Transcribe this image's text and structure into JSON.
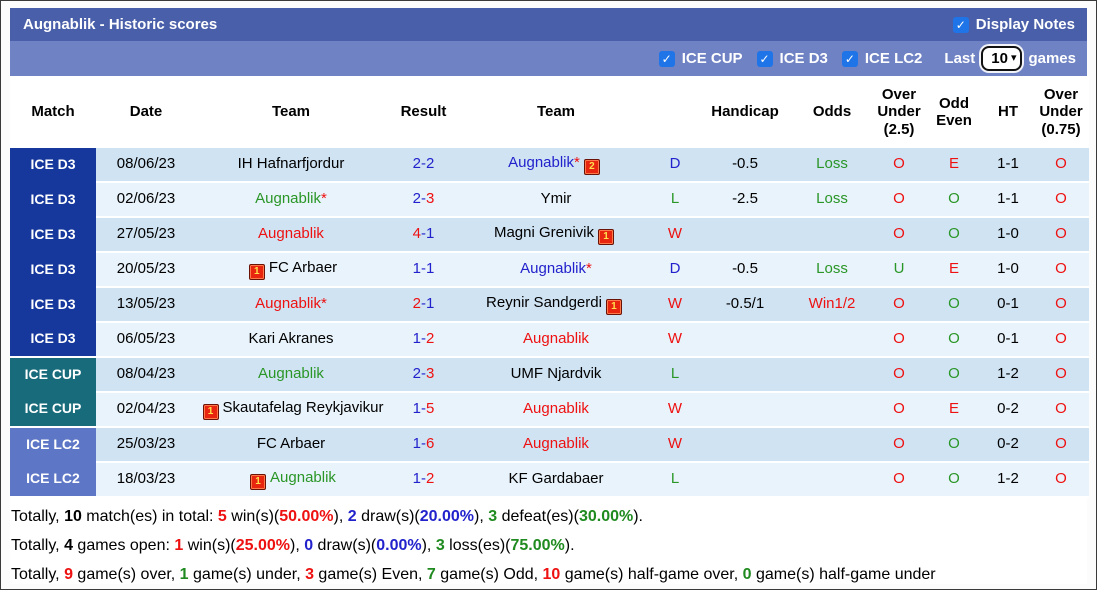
{
  "title_bar": {
    "title": "Augnablik - Historic scores",
    "display_notes_label": "Display Notes",
    "display_notes_checked": true
  },
  "filter_bar": {
    "competitions": [
      {
        "label": "ICE CUP",
        "checked": true
      },
      {
        "label": "ICE D3",
        "checked": true
      },
      {
        "label": "ICE LC2",
        "checked": true
      }
    ],
    "last_label": "Last",
    "last_value": "10",
    "games_label": "games"
  },
  "colors": {
    "title_bar": "#4a5fa9",
    "filter_bar": "#6f82c4",
    "league_ice_d3": "#16389d",
    "league_ice_cup": "#176b7b",
    "league_ice_lc2": "#5d76c5",
    "row_odd": "#cfe3f3",
    "row_even": "#e9f3fb",
    "win_red": "#ee1111",
    "draw_blue": "#2222cc",
    "loss_green": "#2a9627",
    "checkbox_blue": "#1f75e8"
  },
  "table": {
    "columns": [
      "Match",
      "Date",
      "Team",
      "Result",
      "Team",
      "",
      "Handicap",
      "Odds",
      "Over Under (2.5)",
      "Odd Even",
      "HT",
      "Over Under (0.75)"
    ],
    "rows": [
      {
        "league": "ICE D3",
        "lkey": "d3",
        "date": "08/06/23",
        "home": {
          "name": "IH Hafnarfjordur",
          "color": "black"
        },
        "score": {
          "h": "2",
          "a": "2",
          "hc": "blue",
          "ac": "blue"
        },
        "away": {
          "name": "Augnablik",
          "color": "blue",
          "star": true,
          "badge": "2",
          "badge_pos": "after"
        },
        "outcome": {
          "t": "D",
          "c": "blue"
        },
        "handicap": "-0.5",
        "odds": {
          "t": "Loss",
          "c": "green"
        },
        "ou25": {
          "t": "O",
          "c": "red"
        },
        "oe": {
          "t": "E",
          "c": "red"
        },
        "ht": "1-1",
        "ou075": {
          "t": "O",
          "c": "red"
        }
      },
      {
        "league": "ICE D3",
        "lkey": "d3",
        "date": "02/06/23",
        "home": {
          "name": "Augnablik",
          "color": "green",
          "star": true
        },
        "score": {
          "h": "2",
          "a": "3",
          "hc": "blue",
          "ac": "red"
        },
        "away": {
          "name": "Ymir",
          "color": "black"
        },
        "outcome": {
          "t": "L",
          "c": "green"
        },
        "handicap": "-2.5",
        "odds": {
          "t": "Loss",
          "c": "green"
        },
        "ou25": {
          "t": "O",
          "c": "red"
        },
        "oe": {
          "t": "O",
          "c": "green"
        },
        "ht": "1-1",
        "ou075": {
          "t": "O",
          "c": "red"
        }
      },
      {
        "league": "ICE D3",
        "lkey": "d3",
        "date": "27/05/23",
        "home": {
          "name": "Augnablik",
          "color": "red"
        },
        "score": {
          "h": "4",
          "a": "1",
          "hc": "red",
          "ac": "blue"
        },
        "away": {
          "name": "Magni Grenivik",
          "color": "black",
          "badge": "1",
          "badge_pos": "after"
        },
        "outcome": {
          "t": "W",
          "c": "red"
        },
        "handicap": "",
        "odds": {
          "t": "",
          "c": "black"
        },
        "ou25": {
          "t": "O",
          "c": "red"
        },
        "oe": {
          "t": "O",
          "c": "green"
        },
        "ht": "1-0",
        "ou075": {
          "t": "O",
          "c": "red"
        }
      },
      {
        "league": "ICE D3",
        "lkey": "d3",
        "date": "20/05/23",
        "home": {
          "name": "FC Arbaer",
          "color": "black",
          "badge": "1",
          "badge_pos": "before"
        },
        "score": {
          "h": "1",
          "a": "1",
          "hc": "blue",
          "ac": "blue"
        },
        "away": {
          "name": "Augnablik",
          "color": "blue",
          "star": true
        },
        "outcome": {
          "t": "D",
          "c": "blue"
        },
        "handicap": "-0.5",
        "odds": {
          "t": "Loss",
          "c": "green"
        },
        "ou25": {
          "t": "U",
          "c": "green"
        },
        "oe": {
          "t": "E",
          "c": "red"
        },
        "ht": "1-0",
        "ou075": {
          "t": "O",
          "c": "red"
        }
      },
      {
        "league": "ICE D3",
        "lkey": "d3",
        "date": "13/05/23",
        "home": {
          "name": "Augnablik",
          "color": "red",
          "star": true
        },
        "score": {
          "h": "2",
          "a": "1",
          "hc": "red",
          "ac": "blue"
        },
        "away": {
          "name": "Reynir Sandgerdi",
          "color": "black",
          "badge": "1",
          "badge_pos": "after"
        },
        "outcome": {
          "t": "W",
          "c": "red"
        },
        "handicap": "-0.5/1",
        "odds": {
          "t": "Win1/2",
          "c": "red"
        },
        "ou25": {
          "t": "O",
          "c": "red"
        },
        "oe": {
          "t": "O",
          "c": "green"
        },
        "ht": "0-1",
        "ou075": {
          "t": "O",
          "c": "red"
        }
      },
      {
        "league": "ICE D3",
        "lkey": "d3",
        "date": "06/05/23",
        "home": {
          "name": "Kari Akranes",
          "color": "black"
        },
        "score": {
          "h": "1",
          "a": "2",
          "hc": "blue",
          "ac": "red"
        },
        "away": {
          "name": "Augnablik",
          "color": "red"
        },
        "outcome": {
          "t": "W",
          "c": "red"
        },
        "handicap": "",
        "odds": {
          "t": "",
          "c": "black"
        },
        "ou25": {
          "t": "O",
          "c": "red"
        },
        "oe": {
          "t": "O",
          "c": "green"
        },
        "ht": "0-1",
        "ou075": {
          "t": "O",
          "c": "red"
        }
      },
      {
        "league": "ICE CUP",
        "lkey": "cup",
        "date": "08/04/23",
        "home": {
          "name": "Augnablik",
          "color": "green"
        },
        "score": {
          "h": "2",
          "a": "3",
          "hc": "blue",
          "ac": "red"
        },
        "away": {
          "name": "UMF Njardvik",
          "color": "black"
        },
        "outcome": {
          "t": "L",
          "c": "green"
        },
        "handicap": "",
        "odds": {
          "t": "",
          "c": "black"
        },
        "ou25": {
          "t": "O",
          "c": "red"
        },
        "oe": {
          "t": "O",
          "c": "green"
        },
        "ht": "1-2",
        "ou075": {
          "t": "O",
          "c": "red"
        }
      },
      {
        "league": "ICE CUP",
        "lkey": "cup",
        "date": "02/04/23",
        "home": {
          "name": "Skautafelag Reykjavikur",
          "color": "black",
          "badge": "1",
          "badge_pos": "before"
        },
        "score": {
          "h": "1",
          "a": "5",
          "hc": "blue",
          "ac": "red"
        },
        "away": {
          "name": "Augnablik",
          "color": "red"
        },
        "outcome": {
          "t": "W",
          "c": "red"
        },
        "handicap": "",
        "odds": {
          "t": "",
          "c": "black"
        },
        "ou25": {
          "t": "O",
          "c": "red"
        },
        "oe": {
          "t": "E",
          "c": "red"
        },
        "ht": "0-2",
        "ou075": {
          "t": "O",
          "c": "red"
        }
      },
      {
        "league": "ICE LC2",
        "lkey": "lc2",
        "date": "25/03/23",
        "home": {
          "name": "FC Arbaer",
          "color": "black"
        },
        "score": {
          "h": "1",
          "a": "6",
          "hc": "blue",
          "ac": "red"
        },
        "away": {
          "name": "Augnablik",
          "color": "red"
        },
        "outcome": {
          "t": "W",
          "c": "red"
        },
        "handicap": "",
        "odds": {
          "t": "",
          "c": "black"
        },
        "ou25": {
          "t": "O",
          "c": "red"
        },
        "oe": {
          "t": "O",
          "c": "green"
        },
        "ht": "0-2",
        "ou075": {
          "t": "O",
          "c": "red"
        }
      },
      {
        "league": "ICE LC2",
        "lkey": "lc2",
        "date": "18/03/23",
        "home": {
          "name": "Augnablik",
          "color": "green",
          "badge": "1",
          "badge_pos": "before"
        },
        "score": {
          "h": "1",
          "a": "2",
          "hc": "blue",
          "ac": "red"
        },
        "away": {
          "name": "KF Gardabaer",
          "color": "black"
        },
        "outcome": {
          "t": "L",
          "c": "green"
        },
        "handicap": "",
        "odds": {
          "t": "",
          "c": "black"
        },
        "ou25": {
          "t": "O",
          "c": "red"
        },
        "oe": {
          "t": "O",
          "c": "green"
        },
        "ht": "1-2",
        "ou075": {
          "t": "O",
          "c": "red"
        }
      }
    ]
  },
  "summary": [
    [
      {
        "t": "Totally, "
      },
      {
        "t": "10",
        "k": "bold"
      },
      {
        "t": " match(es) in total: "
      },
      {
        "t": "5",
        "k": "red"
      },
      {
        "t": " win(s)("
      },
      {
        "t": "50.00%",
        "k": "red"
      },
      {
        "t": "), "
      },
      {
        "t": "2",
        "k": "blue"
      },
      {
        "t": " draw(s)("
      },
      {
        "t": "20.00%",
        "k": "blue"
      },
      {
        "t": "), "
      },
      {
        "t": "3",
        "k": "green"
      },
      {
        "t": " defeat(es)("
      },
      {
        "t": "30.00%",
        "k": "green"
      },
      {
        "t": ")."
      }
    ],
    [
      {
        "t": "Totally, "
      },
      {
        "t": "4",
        "k": "bold"
      },
      {
        "t": " games open: "
      },
      {
        "t": "1",
        "k": "red"
      },
      {
        "t": " win(s)("
      },
      {
        "t": "25.00%",
        "k": "red"
      },
      {
        "t": "), "
      },
      {
        "t": "0",
        "k": "blue"
      },
      {
        "t": " draw(s)("
      },
      {
        "t": "0.00%",
        "k": "blue"
      },
      {
        "t": "), "
      },
      {
        "t": "3",
        "k": "green"
      },
      {
        "t": " loss(es)("
      },
      {
        "t": "75.00%",
        "k": "green"
      },
      {
        "t": ")."
      }
    ],
    [
      {
        "t": "Totally, "
      },
      {
        "t": "9",
        "k": "red"
      },
      {
        "t": " game(s) over, "
      },
      {
        "t": "1",
        "k": "green"
      },
      {
        "t": " game(s) under, "
      },
      {
        "t": "3",
        "k": "red"
      },
      {
        "t": " game(s) Even, "
      },
      {
        "t": "7",
        "k": "green"
      },
      {
        "t": " game(s) Odd, "
      },
      {
        "t": "10",
        "k": "red"
      },
      {
        "t": " game(s) half-game over, "
      },
      {
        "t": "0",
        "k": "green"
      },
      {
        "t": " game(s) half-game under"
      }
    ]
  ]
}
